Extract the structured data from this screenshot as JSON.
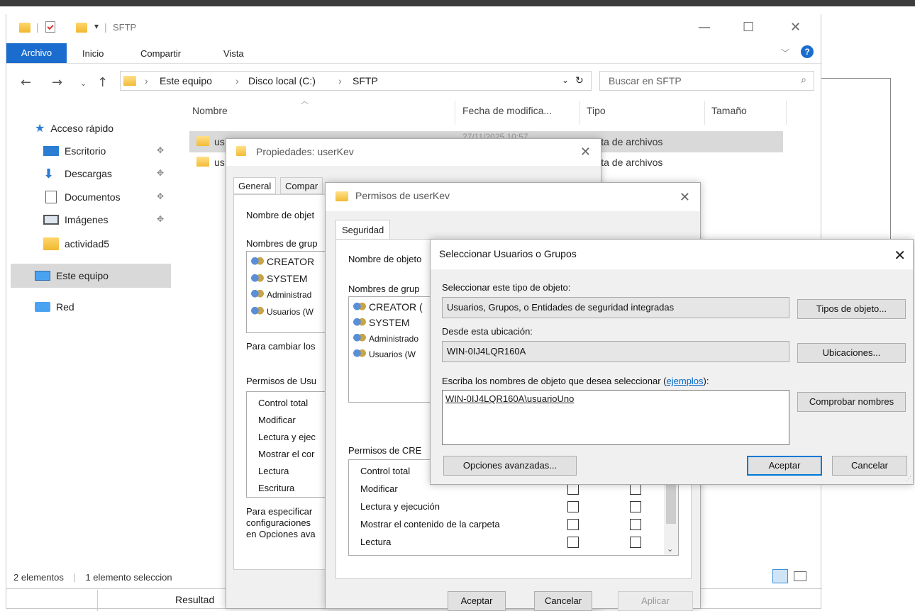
{
  "explorer": {
    "title": "SFTP",
    "ribbon": {
      "file_tab": "Archivo",
      "tabs": [
        "Inicio",
        "Compartir",
        "Vista"
      ]
    },
    "breadcrumb": [
      "Este equipo",
      "Disco local (C:)",
      "SFTP"
    ],
    "search_placeholder": "Buscar en SFTP",
    "sidebar": [
      {
        "label": "Acceso rápido",
        "icon": "star-icon"
      },
      {
        "label": "Escritorio",
        "icon": "desktop-icon",
        "pinned": true
      },
      {
        "label": "Descargas",
        "icon": "download-icon",
        "pinned": true
      },
      {
        "label": "Documentos",
        "icon": "document-icon",
        "pinned": true
      },
      {
        "label": "Imágenes",
        "icon": "pictures-icon",
        "pinned": true
      },
      {
        "label": "actividad5",
        "icon": "folder-icon"
      },
      {
        "label": "Este equipo",
        "icon": "computer-icon",
        "selected": true
      },
      {
        "label": "Red",
        "icon": "network-icon"
      }
    ],
    "columns": [
      "Nombre",
      "Fecha de modifica...",
      "Tipo",
      "Tamaño"
    ],
    "files": [
      {
        "name": "us",
        "date": "27/11/2025 10:57",
        "type": "rpeta de archivos"
      },
      {
        "name": "us",
        "date": "",
        "type": "rpeta de archivos"
      }
    ],
    "status": {
      "count": "2 elementos",
      "selected": "1 elemento seleccion"
    },
    "bottom_text": "Resultad"
  },
  "props_dialog": {
    "title": "Propiedades: userKev",
    "tabs": [
      "General",
      "Compar"
    ],
    "object_name_label": "Nombre de objet",
    "groups_label": "Nombres de grup",
    "groups": [
      "CREATOR",
      "SYSTEM",
      "Administrad",
      "Usuarios (W"
    ],
    "change_label": "Para cambiar los",
    "perms_label": "Permisos de Usu",
    "perms": [
      "Control total",
      "Modificar",
      "Lectura y ejec",
      "Mostrar el cor",
      "Lectura",
      "Escritura"
    ],
    "special_note": [
      "Para especificar",
      "configuraciones",
      "en Opciones ava"
    ]
  },
  "perms_dialog": {
    "title": "Permisos de userKev",
    "tab": "Seguridad",
    "object_name_label": "Nombre de objeto",
    "groups_label": "Nombres de grup",
    "groups": [
      "CREATOR (",
      "SYSTEM",
      "Administrado",
      "Usuarios (W"
    ],
    "perms_label": "Permisos de CRE",
    "perms": [
      "Control total",
      "Modificar",
      "Lectura y ejecución",
      "Mostrar el contenido de la carpeta",
      "Lectura"
    ],
    "buttons": {
      "ok": "Aceptar",
      "cancel": "Cancelar",
      "apply": "Aplicar"
    }
  },
  "select_dialog": {
    "title": "Seleccionar Usuarios o Grupos",
    "type_label": "Seleccionar este tipo de objeto:",
    "type_value": "Usuarios, Grupos, o Entidades de seguridad integradas",
    "type_button": "Tipos de objeto...",
    "location_label": "Desde esta ubicación:",
    "location_value": "WIN-0IJ4LQR160A",
    "location_button": "Ubicaciones...",
    "names_label": "Escriba los nombres de objeto que desea seleccionar (",
    "examples_link": "ejemplos",
    "names_label_end": "):",
    "names_value": "WIN-0IJ4LQR160A\\usuarioUno",
    "check_button": "Comprobar nombres",
    "advanced_button": "Opciones avanzadas...",
    "ok_button": "Aceptar",
    "cancel_button": "Cancelar"
  }
}
